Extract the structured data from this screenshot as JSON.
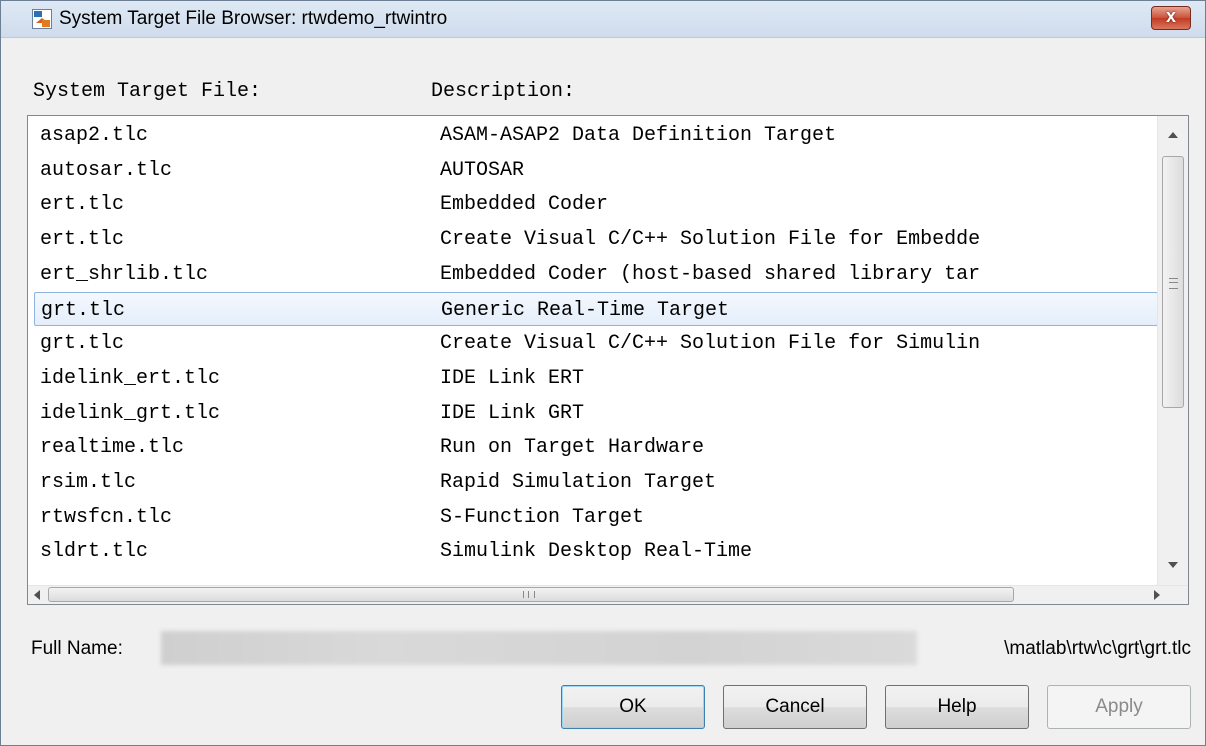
{
  "window": {
    "title": "System Target File Browser: rtwdemo_rtwintro",
    "close_label": "x"
  },
  "headers": {
    "file": "System Target File:",
    "description": "Description:"
  },
  "rows": [
    {
      "file": "asap2.tlc",
      "description": "ASAM-ASAP2 Data Definition Target",
      "selected": false
    },
    {
      "file": "autosar.tlc",
      "description": "AUTOSAR",
      "selected": false
    },
    {
      "file": "ert.tlc",
      "description": "Embedded Coder",
      "selected": false
    },
    {
      "file": "ert.tlc",
      "description": "Create Visual C/C++ Solution File for Embedde",
      "selected": false
    },
    {
      "file": "ert_shrlib.tlc",
      "description": "Embedded Coder (host-based shared library tar",
      "selected": false
    },
    {
      "file": "grt.tlc",
      "description": "Generic Real-Time Target",
      "selected": true
    },
    {
      "file": "grt.tlc",
      "description": "Create Visual C/C++ Solution File for Simulin",
      "selected": false
    },
    {
      "file": "idelink_ert.tlc",
      "description": "IDE Link ERT",
      "selected": false
    },
    {
      "file": "idelink_grt.tlc",
      "description": "IDE Link GRT",
      "selected": false
    },
    {
      "file": "realtime.tlc",
      "description": "Run on Target Hardware",
      "selected": false
    },
    {
      "file": "rsim.tlc",
      "description": "Rapid Simulation Target",
      "selected": false
    },
    {
      "file": "rtwsfcn.tlc",
      "description": "S-Function Target",
      "selected": false
    },
    {
      "file": "sldrt.tlc",
      "description": "Simulink Desktop Real-Time",
      "selected": false
    }
  ],
  "fullname": {
    "label": "Full Name:",
    "path_suffix": "\\matlab\\rtw\\c\\grt\\grt.tlc"
  },
  "buttons": {
    "ok": "OK",
    "cancel": "Cancel",
    "help": "Help",
    "apply": "Apply"
  },
  "colors": {
    "selection_border": "#8fb3e0",
    "close_button": "#c23b22"
  }
}
